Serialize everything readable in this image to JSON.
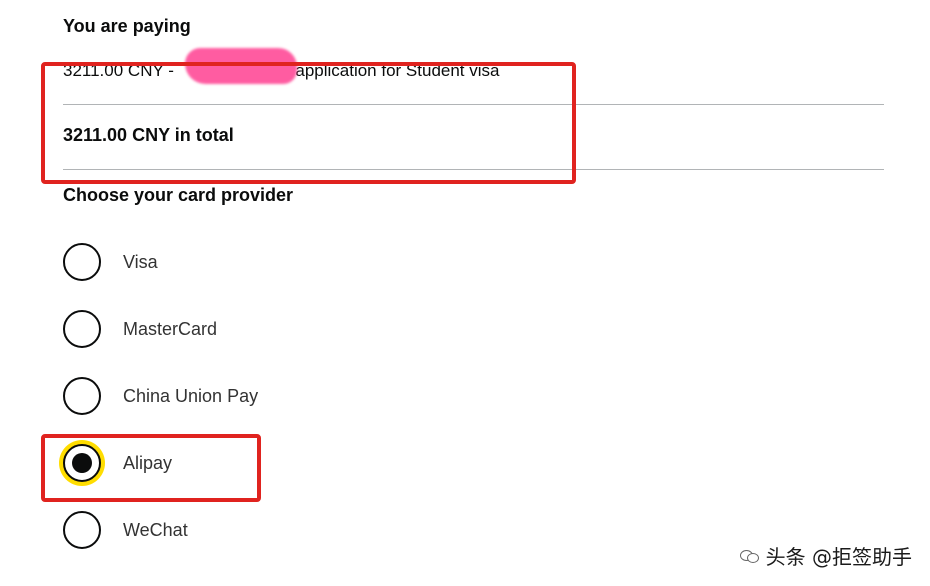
{
  "payment": {
    "heading": "You are paying",
    "line_item_amount": "3211.00 CNY -",
    "line_item_desc": "application for Student visa",
    "total": "3211.00 CNY in total"
  },
  "card_provider": {
    "heading": "Choose your card provider",
    "options": [
      {
        "label": "Visa",
        "selected": false
      },
      {
        "label": "MasterCard",
        "selected": false
      },
      {
        "label": "China Union Pay",
        "selected": false
      },
      {
        "label": "Alipay",
        "selected": true
      },
      {
        "label": "WeChat",
        "selected": false
      }
    ]
  },
  "watermark": {
    "text": "头条 @拒签助手"
  },
  "colors": {
    "annotation_red": "#e0231f",
    "focus_yellow": "#ffdd00",
    "redaction_pink": "#ff4f9a"
  }
}
